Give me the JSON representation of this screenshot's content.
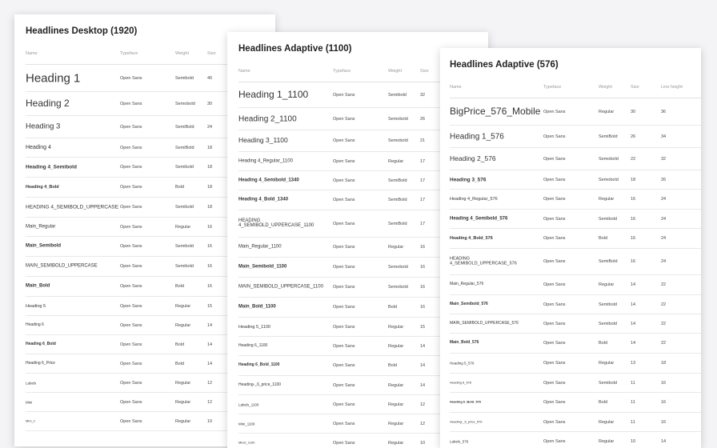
{
  "desktop": {
    "title": "Headlines Desktop (1920)",
    "headers": {
      "name": "Name",
      "typeface": "Typeface",
      "weight": "Weight",
      "size": "Size"
    },
    "rows": [
      {
        "name": "Heading 1",
        "typeface": "Open Sans",
        "weight": "Semibold",
        "size": "40"
      },
      {
        "name": "Heading 2",
        "typeface": "Open Sans",
        "weight": "Semobold",
        "size": "30"
      },
      {
        "name": "Heading 3",
        "typeface": "Open Sans",
        "weight": "SemiBold",
        "size": "24"
      },
      {
        "name": "Heading 4",
        "typeface": "Open Sans",
        "weight": "SemiBold",
        "size": "18"
      },
      {
        "name": "Heading 4_Semibold",
        "typeface": "Open Sans",
        "weight": "Semibold",
        "size": "18"
      },
      {
        "name": "Heading 4_Bold",
        "typeface": "Open Sans",
        "weight": "Bold",
        "size": "18"
      },
      {
        "name": "HEADING 4_SEMIBOLD_UPPERCASE",
        "typeface": "Open Sans",
        "weight": "Semibold",
        "size": "18"
      },
      {
        "name": "Main_Regular",
        "typeface": "Open Sans",
        "weight": "Regular",
        "size": "16"
      },
      {
        "name": "Main_Semibold",
        "typeface": "Open Sans",
        "weight": "Semibold",
        "size": "16"
      },
      {
        "name": "MAIN_SEMIBOLD_UPPERCASE",
        "typeface": "Open Sans",
        "weight": "Semibold",
        "size": "16"
      },
      {
        "name": "Main_Bold",
        "typeface": "Open Sans",
        "weight": "Bold",
        "size": "16"
      },
      {
        "name": "Heading 5",
        "typeface": "Open Sans",
        "weight": "Regular",
        "size": "15"
      },
      {
        "name": "Heading 6",
        "typeface": "Open Sans",
        "weight": "Regular",
        "size": "14"
      },
      {
        "name": "Heading 6_Bold",
        "typeface": "Open Sans",
        "weight": "Bold",
        "size": "14"
      },
      {
        "name": "Heading 6_Price",
        "typeface": "Open Sans",
        "weight": "Bold",
        "size": "14"
      },
      {
        "name": "Labels",
        "typeface": "Open Sans",
        "weight": "Regular",
        "size": "12"
      },
      {
        "name": "Mini",
        "typeface": "Open Sans",
        "weight": "Regular",
        "size": "12"
      },
      {
        "name": "Mini_2",
        "typeface": "Open Sans",
        "weight": "Regular",
        "size": "10"
      }
    ]
  },
  "adaptive1100": {
    "title": "Headlines Adaptive (1100)",
    "headers": {
      "name": "Name",
      "typeface": "Typeface",
      "weight": "Weight",
      "size": "Size"
    },
    "rows": [
      {
        "name": "Heading 1_1100",
        "typeface": "Open Sans",
        "weight": "Semibold",
        "size": "32"
      },
      {
        "name": "Heading 2_1100",
        "typeface": "Open Sans",
        "weight": "Semobold",
        "size": "26"
      },
      {
        "name": "Heading 3_1100",
        "typeface": "Open Sans",
        "weight": "Semobold",
        "size": "21"
      },
      {
        "name": "Heading 4_Regular_1100",
        "typeface": "Open Sans",
        "weight": "Regular",
        "size": "17"
      },
      {
        "name": "Heading 4_Semibold_1340",
        "typeface": "Open Sans",
        "weight": "SemiBold",
        "size": "17"
      },
      {
        "name": "Heading 4_Bold_1340",
        "typeface": "Open Sans",
        "weight": "SemiBold",
        "size": "17"
      },
      {
        "name": "HEADING\n4_SEMIBOLD_UPPERCASE_1100",
        "typeface": "Open Sans",
        "weight": "SemiBold",
        "size": "17"
      },
      {
        "name": "Main_Regular_1100",
        "typeface": "Open Sans",
        "weight": "Regular",
        "size": "16"
      },
      {
        "name": "Main_Semibold_1100",
        "typeface": "Open Sans",
        "weight": "Semobold",
        "size": "16"
      },
      {
        "name": "MAIN_SEMIBOLD_UPPERCASE_1100",
        "typeface": "Open Sans",
        "weight": "Semobold",
        "size": "16"
      },
      {
        "name": "Main_Bold_1100",
        "typeface": "Open Sans",
        "weight": "Bold",
        "size": "16"
      },
      {
        "name": "Heading 5_1100",
        "typeface": "Open Sans",
        "weight": "Regular",
        "size": "15"
      },
      {
        "name": "Heading 6_1100",
        "typeface": "Open Sans",
        "weight": "Regular",
        "size": "14"
      },
      {
        "name": "Heading 6_Bold_1100",
        "typeface": "Open Sans",
        "weight": "Bold",
        "size": "14"
      },
      {
        "name": "Heading-_6_price_1100",
        "typeface": "Open Sans",
        "weight": "Regular",
        "size": "14"
      },
      {
        "name": "Labels_1100",
        "typeface": "Open Sans",
        "weight": "Regular",
        "size": "12"
      },
      {
        "name": "Mini_1100",
        "typeface": "Open Sans",
        "weight": "Regular",
        "size": "12"
      },
      {
        "name": "Mini2_1100",
        "typeface": "Open Sans",
        "weight": "Regular",
        "size": "10"
      }
    ]
  },
  "adaptive576": {
    "title": "Headlines Adaptive (576)",
    "headers": {
      "name": "Name",
      "typeface": "Typeface",
      "weight": "Weight",
      "size": "Size",
      "line_height": "Line height"
    },
    "rows": [
      {
        "name": "BigPrice_576_Mobile",
        "typeface": "Open Sans",
        "weight": "Regular",
        "size": "30",
        "line_height": "36"
      },
      {
        "name": "Heading 1_576",
        "typeface": "Open Sans",
        "weight": "SemiBold",
        "size": "26",
        "line_height": "34"
      },
      {
        "name": "Heading 2_576",
        "typeface": "Open Sans",
        "weight": "Semobold",
        "size": "22",
        "line_height": "32"
      },
      {
        "name": "Heading 3_576",
        "typeface": "Open Sans",
        "weight": "Semobold",
        "size": "18",
        "line_height": "26"
      },
      {
        "name": "Heading 4_Regular_576",
        "typeface": "Open Sans",
        "weight": "Regular",
        "size": "16",
        "line_height": "24"
      },
      {
        "name": "Heading 4_Semibold_576",
        "typeface": "Open Sans",
        "weight": "Semibold",
        "size": "16",
        "line_height": "24"
      },
      {
        "name": "Heading 4_Bold_576",
        "typeface": "Open Sans",
        "weight": "Bold",
        "size": "16",
        "line_height": "24"
      },
      {
        "name": "HEADING\n4_SEMIBOLD_UPPERCASE_576",
        "typeface": "Open Sans",
        "weight": "SemiBold",
        "size": "16",
        "line_height": "24"
      },
      {
        "name": "Main_Regular_576",
        "typeface": "Open Sans",
        "weight": "Regular",
        "size": "14",
        "line_height": "22"
      },
      {
        "name": "Main_Semibold_576",
        "typeface": "Open Sans",
        "weight": "Semibold",
        "size": "14",
        "line_height": "22"
      },
      {
        "name": "MAIN_SEMIBOLD_UPPERCASE_576",
        "typeface": "Open Sans",
        "weight": "Semibold",
        "size": "14",
        "line_height": "22"
      },
      {
        "name": "Main_Bold_576",
        "typeface": "Open Sans",
        "weight": "Bold",
        "size": "14",
        "line_height": "22"
      },
      {
        "name": "Heading 5_576",
        "typeface": "Open Sans",
        "weight": "Regular",
        "size": "13",
        "line_height": "18"
      },
      {
        "name": "Heading 6_576",
        "typeface": "Open Sans",
        "weight": "Semibold",
        "size": "11",
        "line_height": "16"
      },
      {
        "name": "Heading 6_Bold_576",
        "typeface": "Open Sans",
        "weight": "Bold",
        "size": "11",
        "line_height": "16"
      },
      {
        "name": "Heading-_6_price_576",
        "typeface": "Open Sans",
        "weight": "Regular",
        "size": "11",
        "line_height": "16"
      },
      {
        "name": "Labels_576",
        "typeface": "Open Sans",
        "weight": "Regular",
        "size": "10",
        "line_height": "14"
      }
    ]
  }
}
